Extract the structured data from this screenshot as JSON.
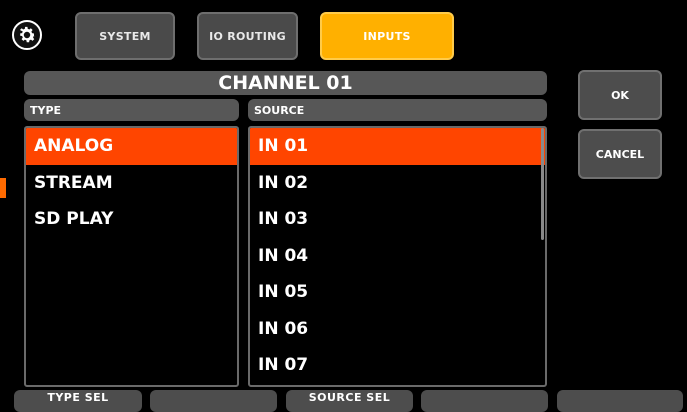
{
  "top_tabs": [
    {
      "label": "SYSTEM",
      "state": "inactive"
    },
    {
      "label": "IO ROUTING",
      "state": "inactive"
    },
    {
      "label": "INPUTS",
      "state": "active"
    }
  ],
  "header": {
    "title": "CHANNEL 01"
  },
  "type_panel": {
    "heading": "TYPE",
    "items": [
      "ANALOG",
      "STREAM",
      "SD PLAY"
    ],
    "selected": "ANALOG"
  },
  "source_panel": {
    "heading": "SOURCE",
    "items": [
      "IN 01",
      "IN 02",
      "IN 03",
      "IN 04",
      "IN 05",
      "IN 06",
      "IN 07"
    ],
    "selected": "IN 01"
  },
  "actions": {
    "ok_label": "OK",
    "cancel_label": "CANCEL"
  },
  "bottom_bar": {
    "softkeys": [
      "TYPE SEL",
      "",
      "SOURCE SEL",
      "",
      ""
    ]
  },
  "colors": {
    "accent_tab": "#ffb000",
    "selection": "#ff4500",
    "panel": "#575757"
  },
  "icons": {
    "settings": "gear-icon"
  }
}
